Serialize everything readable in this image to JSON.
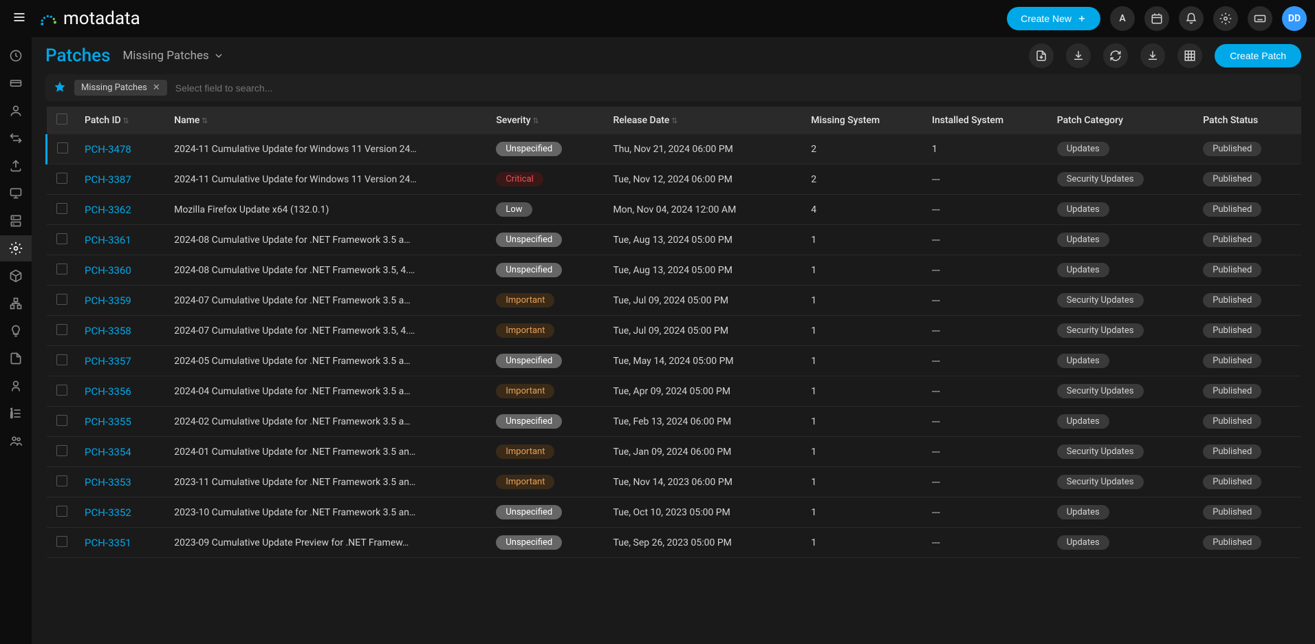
{
  "header": {
    "logo_text": "motadata",
    "create_new": "Create New",
    "letter_icon": "A",
    "avatar": "DD"
  },
  "subheader": {
    "title": "Patches",
    "filter_label": "Missing Patches",
    "create_patch": "Create Patch"
  },
  "filterbar": {
    "chip_label": "Missing Patches",
    "search_placeholder": "Select field to search..."
  },
  "columns": {
    "patch_id": "Patch ID",
    "name": "Name",
    "severity": "Severity",
    "release_date": "Release Date",
    "missing_system": "Missing System",
    "installed_system": "Installed System",
    "patch_category": "Patch Category",
    "patch_status": "Patch Status"
  },
  "rows": [
    {
      "id": "PCH-3478",
      "name": "2024-11 Cumulative Update for Windows 11 Version 24…",
      "severity": "Unspecified",
      "date": "Thu, Nov 21, 2024 06:00 PM",
      "missing": "2",
      "installed": "1",
      "category": "Updates",
      "status": "Published",
      "hl": true
    },
    {
      "id": "PCH-3387",
      "name": "2024-11 Cumulative Update for Windows 11 Version 24…",
      "severity": "Critical",
      "date": "Tue, Nov 12, 2024 06:00 PM",
      "missing": "2",
      "installed": "---",
      "category": "Security Updates",
      "status": "Published"
    },
    {
      "id": "PCH-3362",
      "name": "Mozilla Firefox Update x64 (132.0.1)",
      "severity": "Low",
      "date": "Mon, Nov 04, 2024 12:00 AM",
      "missing": "4",
      "installed": "---",
      "category": "Updates",
      "status": "Published"
    },
    {
      "id": "PCH-3361",
      "name": "2024-08 Cumulative Update for .NET Framework 3.5 a…",
      "severity": "Unspecified",
      "date": "Tue, Aug 13, 2024 05:00 PM",
      "missing": "1",
      "installed": "---",
      "category": "Updates",
      "status": "Published"
    },
    {
      "id": "PCH-3360",
      "name": "2024-08 Cumulative Update for .NET Framework 3.5, 4.…",
      "severity": "Unspecified",
      "date": "Tue, Aug 13, 2024 05:00 PM",
      "missing": "1",
      "installed": "---",
      "category": "Updates",
      "status": "Published"
    },
    {
      "id": "PCH-3359",
      "name": "2024-07 Cumulative Update for .NET Framework 3.5 a…",
      "severity": "Important",
      "date": "Tue, Jul 09, 2024 05:00 PM",
      "missing": "1",
      "installed": "---",
      "category": "Security Updates",
      "status": "Published"
    },
    {
      "id": "PCH-3358",
      "name": "2024-07 Cumulative Update for .NET Framework 3.5, 4.…",
      "severity": "Important",
      "date": "Tue, Jul 09, 2024 05:00 PM",
      "missing": "1",
      "installed": "---",
      "category": "Security Updates",
      "status": "Published"
    },
    {
      "id": "PCH-3357",
      "name": "2024-05 Cumulative Update for .NET Framework 3.5 a…",
      "severity": "Unspecified",
      "date": "Tue, May 14, 2024 05:00 PM",
      "missing": "1",
      "installed": "---",
      "category": "Updates",
      "status": "Published"
    },
    {
      "id": "PCH-3356",
      "name": "2024-04 Cumulative Update for .NET Framework 3.5 a…",
      "severity": "Important",
      "date": "Tue, Apr 09, 2024 05:00 PM",
      "missing": "1",
      "installed": "---",
      "category": "Security Updates",
      "status": "Published"
    },
    {
      "id": "PCH-3355",
      "name": "2024-02 Cumulative Update for .NET Framework 3.5 a…",
      "severity": "Unspecified",
      "date": "Tue, Feb 13, 2024 06:00 PM",
      "missing": "1",
      "installed": "---",
      "category": "Updates",
      "status": "Published"
    },
    {
      "id": "PCH-3354",
      "name": "2024-01 Cumulative Update for .NET Framework 3.5 an…",
      "severity": "Important",
      "date": "Tue, Jan 09, 2024 06:00 PM",
      "missing": "1",
      "installed": "---",
      "category": "Security Updates",
      "status": "Published"
    },
    {
      "id": "PCH-3353",
      "name": "2023-11 Cumulative Update for .NET Framework 3.5 an…",
      "severity": "Important",
      "date": "Tue, Nov 14, 2023 06:00 PM",
      "missing": "1",
      "installed": "---",
      "category": "Security Updates",
      "status": "Published"
    },
    {
      "id": "PCH-3352",
      "name": "2023-10 Cumulative Update for .NET Framework 3.5 an…",
      "severity": "Unspecified",
      "date": "Tue, Oct 10, 2023 05:00 PM",
      "missing": "1",
      "installed": "---",
      "category": "Updates",
      "status": "Published"
    },
    {
      "id": "PCH-3351",
      "name": "2023-09 Cumulative Update Preview for .NET Framew…",
      "severity": "Unspecified",
      "date": "Tue, Sep 26, 2023 05:00 PM",
      "missing": "1",
      "installed": "---",
      "category": "Updates",
      "status": "Published"
    }
  ]
}
